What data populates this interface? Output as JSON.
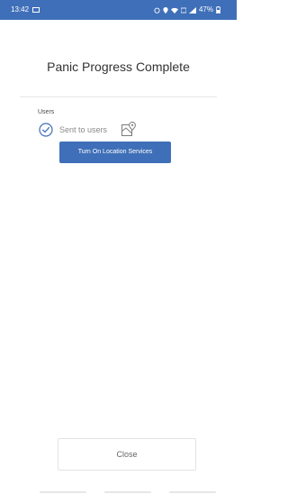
{
  "status_bar": {
    "time": "13:42",
    "battery": "47%",
    "color": "#3f6fb8"
  },
  "page": {
    "title": "Panic Progress Complete"
  },
  "users_section": {
    "label": "Users",
    "sent_text": "Sent to users",
    "check_icon": "check-circle-icon",
    "map_icon": "map-location-icon"
  },
  "location_button": {
    "label": "Turn On Location Services"
  },
  "close_button": {
    "label": "Close"
  }
}
